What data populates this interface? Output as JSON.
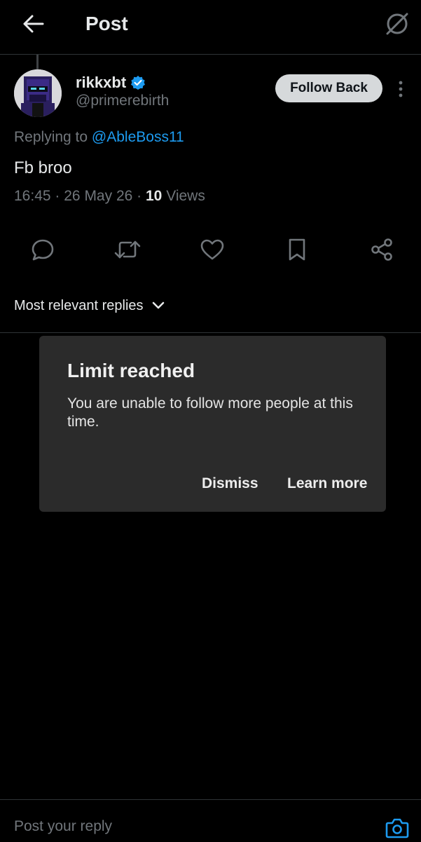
{
  "header": {
    "title": "Post",
    "back_icon": "arrow-left-icon",
    "grok_icon": "grok-icon"
  },
  "post": {
    "author": {
      "name": "rikkxbt",
      "handle": "@primerebirth",
      "verified": true,
      "verified_color": "#1d9bf0"
    },
    "follow_button": "Follow Back",
    "replying_to_prefix": "Replying to",
    "replying_to_handle": "@AbleBoss11",
    "text": "Fb broo",
    "time": "16:45",
    "date": "26 May 26",
    "views_count": "10",
    "views_label": "Views",
    "separator": "·"
  },
  "actions": [
    "reply-icon",
    "repost-icon",
    "like-icon",
    "bookmark-icon",
    "share-icon"
  ],
  "replies": {
    "sort_label": "Most relevant replies"
  },
  "dialog": {
    "title": "Limit reached",
    "body": "You are unable to follow more people at this time.",
    "dismiss": "Dismiss",
    "learn_more": "Learn more"
  },
  "reply_bar": {
    "placeholder": "Post your reply"
  },
  "colors": {
    "background": "#000000",
    "accent": "#1d9bf0",
    "muted": "#71767b",
    "dialog_bg": "#2b2b2b"
  }
}
